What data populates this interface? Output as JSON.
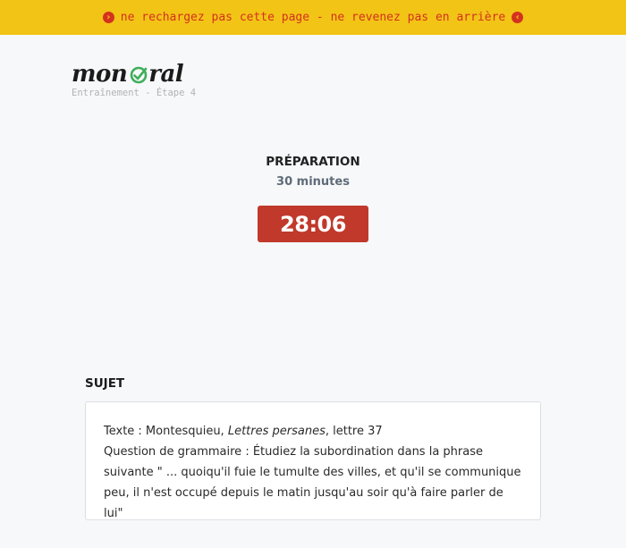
{
  "banner": {
    "text": "ne rechargez pas cette page - ne revenez pas en arrière",
    "left_icon": "chevron-right-circle-icon",
    "right_icon": "chevron-left-circle-icon",
    "color": "#d4321f",
    "background": "#f2c416"
  },
  "logo": {
    "text_before": "mon ",
    "text_after": "ral",
    "check_color": "#3fae5a"
  },
  "step_label": "Entraînement - Étape 4",
  "preparation": {
    "title": "PRÉPARATION",
    "duration": "30 minutes",
    "timer": "28:06",
    "timer_color": "#c0392b"
  },
  "sujet": {
    "heading": "SUJET",
    "texte_prefix": "Texte : Montesquieu, ",
    "texte_work": "Lettres persanes",
    "texte_suffix": ", lettre 37",
    "question_line1": "Question de grammaire : Étudiez la subordination dans la phrase",
    "question_line2": "suivante \" ... quoiqu'il fuie le tumulte des villes, et qu'il se communique",
    "question_line3": "peu, il n'est occupé depuis le matin jusqu'au soir qu'à faire parler de lui\""
  }
}
